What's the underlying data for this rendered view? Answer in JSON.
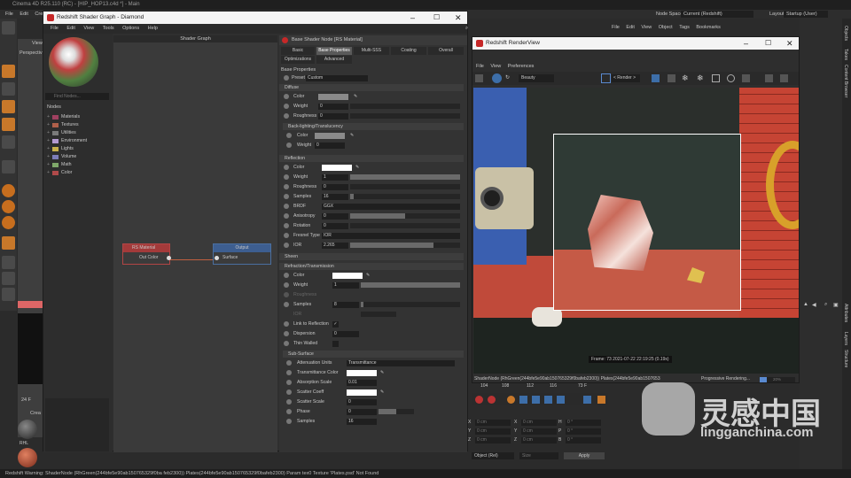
{
  "app": {
    "title": "Cinema 4D R25.110 (RC) - [HIP_HOP13.c4d *] - Main",
    "menu": [
      "File",
      "Edit",
      "Crea"
    ],
    "node_space_label": "Node Space:",
    "node_space_value": "Current (Redshift)",
    "layout_label": "Layout:",
    "layout_value": "Startup (User)",
    "obj_menu": [
      "File",
      "Edit",
      "View",
      "Object",
      "Tags",
      "Bookmarks"
    ],
    "viewport_labels": {
      "view": "View",
      "perspective": "Perspectiv"
    },
    "frame_field": "24 F",
    "create_label": "Crea",
    "material_label": "RHL",
    "coords": {
      "rows": [
        {
          "axis": "X",
          "pos": "0 cm",
          "axis2": "X",
          "size": "0 cm",
          "axis3": "H",
          "rot": "0 °"
        },
        {
          "axis": "Y",
          "pos": "0 cm",
          "axis2": "Y",
          "size": "0 cm",
          "axis3": "P",
          "rot": "0 °"
        },
        {
          "axis": "Z",
          "pos": "0 cm",
          "axis2": "Z",
          "size": "0 cm",
          "axis3": "B",
          "rot": "0 °"
        }
      ],
      "mode": "Object (Rel)",
      "size_mode": "Size",
      "apply": "Apply"
    },
    "timeline": {
      "ticks": [
        "104",
        "108",
        "112",
        "116"
      ],
      "frame": "73 F"
    },
    "status": "Redshift Warning: ShaderNode (RhGreen(244bfe5e90ab150765329f0ba feb2300)) Plates(244bfe5e90ab150765329f0bafeb2300) Param tex0 Texture 'Plates.psd' Not Found",
    "side_tabs": [
      "Objects",
      "Takes",
      "Content Browser",
      "Attributes",
      "Layers",
      "Structure"
    ],
    "watermark": {
      "cn": "灵感中国",
      "en": "lingganchina.com"
    }
  },
  "shader_graph": {
    "title": "Redshift Shader Graph - Diamond",
    "menu": [
      "File",
      "Edit",
      "View",
      "Tools",
      "Options",
      "Help"
    ],
    "graph_header": "Shader Graph",
    "find_placeholder": "Find Nodes...",
    "nodes_header": "Nodes",
    "node_tree": [
      {
        "label": "Materials",
        "color": "#a04060"
      },
      {
        "label": "Textures",
        "color": "#b0604a"
      },
      {
        "label": "Utilities",
        "color": "#7a7a7a"
      },
      {
        "label": "Environment",
        "color": "#b49ad0"
      },
      {
        "label": "Lights",
        "color": "#c8b04a"
      },
      {
        "label": "Volume",
        "color": "#7d7db8"
      },
      {
        "label": "Math",
        "color": "#7fa86a"
      },
      {
        "label": "Color",
        "color": "#b04a4a"
      }
    ],
    "node_rs": {
      "title": "RS Material",
      "port": "Out Color"
    },
    "node_out": {
      "title": "Output",
      "port": "Surface"
    },
    "props_title": "Base Shader Node [RS Material]",
    "tabs": [
      "Basic",
      "Base Properties",
      "Multi-SSS",
      "Coating",
      "Overall",
      "Optimizations",
      "Advanced"
    ],
    "base_props_label": "Base Properties",
    "preset_label": "Preset",
    "preset_value": "Custom",
    "sections": {
      "diffuse": "Diffuse",
      "backlight": "Back-lighting/Translucency",
      "reflection": "Reflection",
      "sheen": "Sheen",
      "refraction": "Refraction/Transmission",
      "subsurface": "Sub-Surface"
    },
    "diffuse": {
      "color": "Color",
      "weight": "Weight",
      "weight_val": "0",
      "rough": "Roughness",
      "rough_val": "0"
    },
    "backlight": {
      "color": "Color",
      "weight": "Weight",
      "weight_val": "0"
    },
    "reflection": {
      "color": "Color",
      "weight": "Weight",
      "weight_val": "1",
      "rough": "Roughness",
      "rough_val": "0",
      "samples": "Samples",
      "samples_val": "16",
      "brdf": "BRDF",
      "brdf_val": "GGX",
      "aniso": "Anisotropy",
      "aniso_val": "0",
      "rotation": "Rotation",
      "rotation_val": "0",
      "fresnel": "Fresnel Type",
      "fresnel_val": "IOR",
      "ior": "IOR",
      "ior_val": "2.265"
    },
    "refraction": {
      "color": "Color",
      "weight": "Weight",
      "weight_val": "1",
      "rough": "Roughness",
      "samples": "Samples",
      "samples_val": "8",
      "ior": "IOR",
      "link": "Link to Reflection",
      "dispersion": "Dispersion",
      "dispersion_val": "0",
      "thin": "Thin Walled"
    },
    "subsurface": {
      "atten": "Attenuation Units",
      "atten_val": "Transmittance",
      "tcolor": "Transmittance Color",
      "abs": "Absorption Scale",
      "abs_val": "0.01",
      "scatter": "Scatter Coeff",
      "sscale": "Scatter Scale",
      "sscale_val": "0",
      "phase": "Phase",
      "phase_val": "0",
      "samples": "Samples",
      "samples_val": "16"
    }
  },
  "render_view": {
    "title": "Redshift RenderView",
    "menu": [
      "File",
      "View",
      "Preferences"
    ],
    "beauty": "Beauty",
    "render_btn": "< Render >",
    "frame_info": "Frame: 73  2021-07-22  22:19:25  (0.19s)",
    "footer_left": "ShaderNode (RhGreen(244bfe5e90ab150765329f0bafeb2300)) Plates(244bfe5e90ab150765329f0bafeb2300)",
    "footer_right": "Progressive Rendering...",
    "progress_pct": "20%",
    "progress": 0.2
  }
}
